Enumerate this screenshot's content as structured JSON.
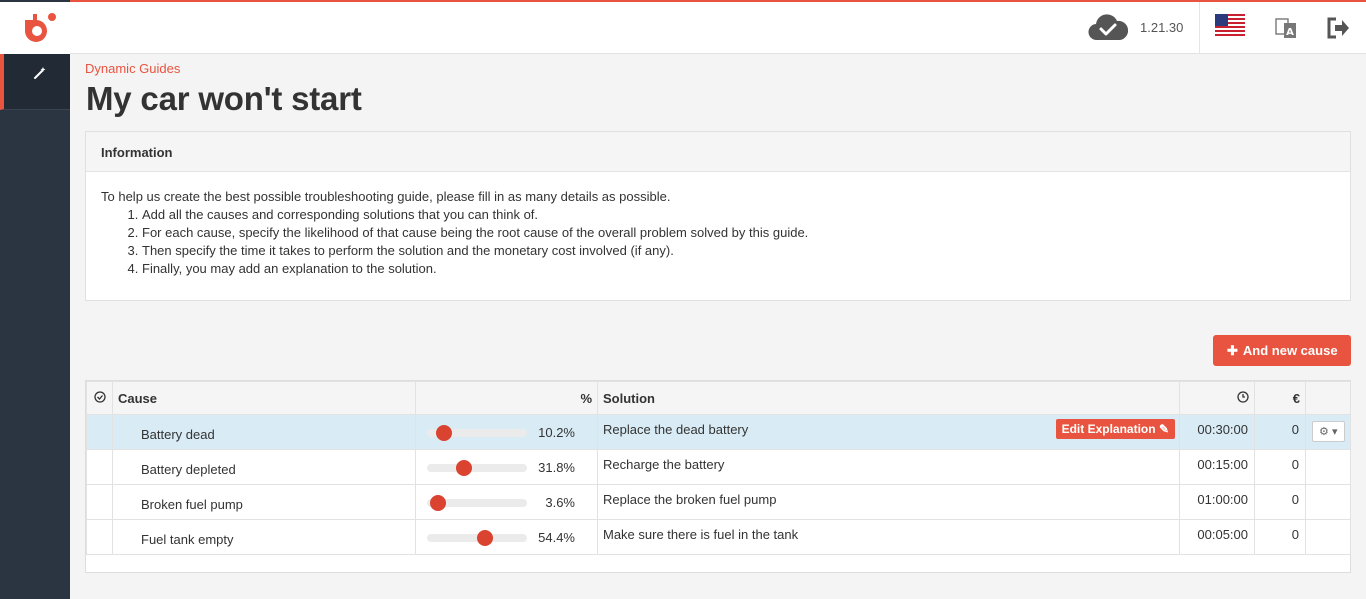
{
  "app": {
    "version": "1.21.30"
  },
  "page": {
    "breadcrumb": "Dynamic Guides",
    "title": "My car won't start"
  },
  "info": {
    "heading": "Information",
    "intro": "To help us create the best possible troubleshooting guide, please fill in as many details as possible.",
    "steps": [
      "Add all the causes and corresponding solutions that you can think of.",
      "For each cause, specify the likelihood of that cause being the root cause of the overall problem solved by this guide.",
      "Then specify the time it takes to perform the solution and the monetary cost involved (if any).",
      "Finally, you may add an explanation to the solution."
    ]
  },
  "actions": {
    "add_cause": "And new cause"
  },
  "table": {
    "headers": {
      "cause": "Cause",
      "pct": "%",
      "solution": "Solution",
      "cost": "€"
    },
    "edit_label": "Edit Explanation",
    "rows": [
      {
        "cause": "Battery dead",
        "pct": 10.2,
        "pct_label": "10.2%",
        "solution": "Replace the dead battery",
        "time": "00:30:00",
        "cost": "0"
      },
      {
        "cause": "Battery depleted",
        "pct": 31.8,
        "pct_label": "31.8%",
        "solution": "Recharge the battery",
        "time": "00:15:00",
        "cost": "0"
      },
      {
        "cause": "Broken fuel pump",
        "pct": 3.6,
        "pct_label": "3.6%",
        "solution": "Replace the broken fuel pump",
        "time": "01:00:00",
        "cost": "0"
      },
      {
        "cause": "Fuel tank empty",
        "pct": 54.4,
        "pct_label": "54.4%",
        "solution": "Make sure there is fuel in the tank",
        "time": "00:05:00",
        "cost": "0"
      }
    ]
  },
  "colors": {
    "accent": "#e8543f",
    "sidebar": "#2b3541",
    "selected_row": "#d9ecf5"
  }
}
